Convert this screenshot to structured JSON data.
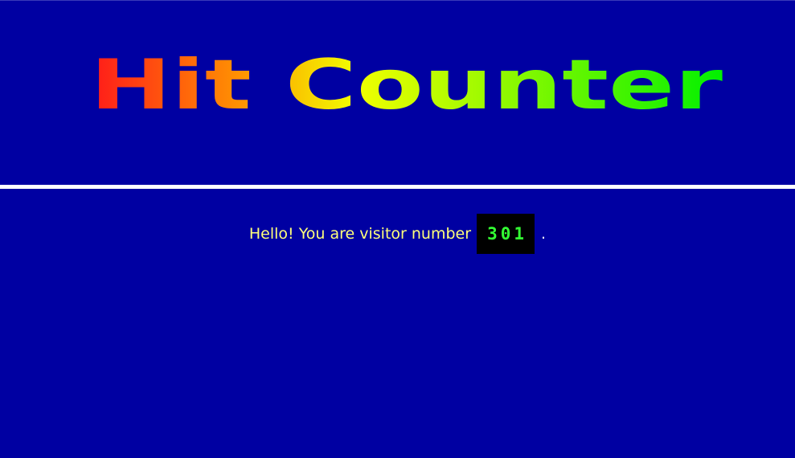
{
  "title": {
    "text": "Hit Counter",
    "gradient": {
      "start": "#ff1a1a",
      "middle_orange": "#ff9900",
      "middle_yellow": "#f2ff00",
      "end": "#00f000"
    }
  },
  "message": {
    "prefix": "Hello! You are visitor number",
    "count": "301",
    "suffix": "."
  },
  "colors": {
    "background": "#0000a2",
    "divider": "#ffffff",
    "message_text": "#ffff7a",
    "counter_bg": "#000000",
    "counter_text": "#33ff33"
  }
}
